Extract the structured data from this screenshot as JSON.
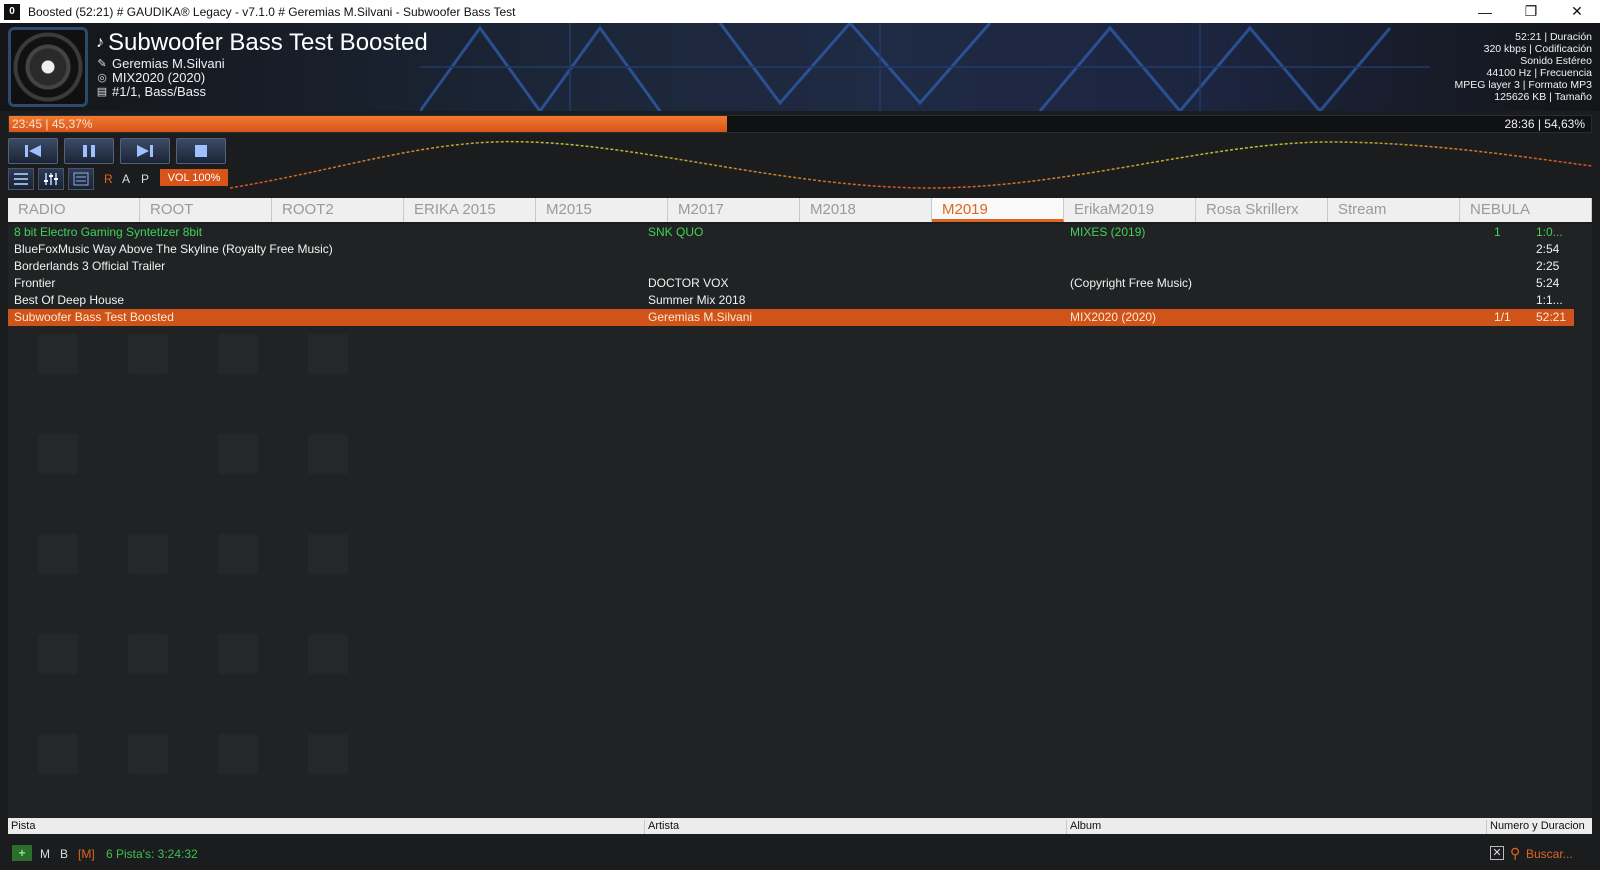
{
  "window": {
    "title": "Boosted  (52:21) # GAUDIKA® Legacy - v7.1.0 # Geremias M.Silvani - Subwoofer Bass Test"
  },
  "now_playing": {
    "title": "Subwoofer Bass Test Boosted",
    "artist": "Geremias M.Silvani",
    "album": "MIX2020 (2020)",
    "track_info": "#1/1, Bass/Bass"
  },
  "tech_info": {
    "duration": "52:21 | Duración",
    "bitrate": "320 kbps | Codificación",
    "channels": "Sonido Estéreo",
    "frequency": "44100 Hz | Frecuencia",
    "format": "MPEG layer 3 | Formato MP3",
    "size": "125626 KB | Tamaño"
  },
  "progress": {
    "elapsed": "23:45 | 45,37%",
    "remaining": "28:36 | 54,63%",
    "fraction": 0.4537
  },
  "controls": {
    "r": "R",
    "a": "A",
    "p": "P",
    "volume": "VOL 100%"
  },
  "tabs": [
    "RADIO",
    "ROOT",
    "ROOT2",
    "ERIKA 2015",
    "M2015",
    "M2017",
    "M2018",
    "M2019",
    "ErikaM2019",
    "Rosa Skrillerx",
    "Stream",
    "NEBULA"
  ],
  "active_tab": "M2019",
  "playlist": [
    {
      "track": "8 bit Electro Gaming Syntetizer 8bit",
      "artist": "SNK QUO",
      "album": "MIXES (2019)",
      "number": "1",
      "duration": "1:0...",
      "state": "green"
    },
    {
      "track": "BlueFoxMusic Way Above The Skyline (Royalty Free Music)",
      "artist": "",
      "album": "",
      "number": "",
      "duration": "2:54",
      "state": ""
    },
    {
      "track": "Borderlands 3 Official Trailer",
      "artist": "",
      "album": "",
      "number": "",
      "duration": "2:25",
      "state": ""
    },
    {
      "track": "Frontier",
      "artist": "DOCTOR VOX",
      "album": "(Copyright Free Music)",
      "number": "",
      "duration": "5:24",
      "state": ""
    },
    {
      "track": "Best Of Deep House",
      "artist": "Summer Mix 2018",
      "album": "",
      "number": "",
      "duration": "1:1...",
      "state": ""
    },
    {
      "track": "Subwoofer Bass Test Boosted",
      "artist": "Geremias M.Silvani",
      "album": "MIX2020 (2020)",
      "number": "1/1",
      "duration": "52:21",
      "state": "playing"
    }
  ],
  "columns": {
    "track": "Pista",
    "artist": "Artista",
    "album": "Album",
    "num_dur": "Numero y Duracion"
  },
  "status": {
    "plus": "+",
    "m": "M",
    "b": "B",
    "mode": "[M]",
    "count": "6 Pista's: 3:24:32",
    "search": "Buscar..."
  },
  "colors": {
    "accent": "#e0651f",
    "playing_row": "#d0531a",
    "green_text": "#3fd35a"
  }
}
